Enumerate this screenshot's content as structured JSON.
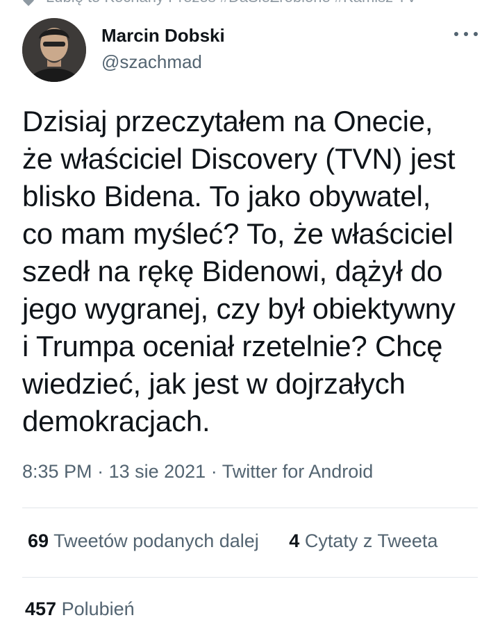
{
  "top_context": {
    "text": "Lubię to Kochany Prezes #DaSieZrobione #Kamisz TV"
  },
  "author": {
    "name": "Marcin Dobski",
    "handle": "@szachmad"
  },
  "tweet": {
    "lines": [
      "Dzisiaj przeczytałem na Onecie,",
      "że właściciel Discovery (TVN) jest",
      "blisko Bidena. To jako obywatel,",
      "co mam myśleć? To, że właściciel",
      "szedł na rękę Bidenowi, dążył do",
      "jego wygranej, czy był obiektywny",
      "i Trumpa oceniał rzetelnie? Chcę",
      "wiedzieć, jak jest w dojrzałych",
      "demokracjach."
    ]
  },
  "meta": {
    "time": "8:35 PM",
    "separator": " · ",
    "date": "13 sie 2021",
    "source": "Twitter for Android"
  },
  "stats": {
    "retweets_count": "69",
    "retweets_label": "Tweetów podanych dalej",
    "quotes_count": "4",
    "quotes_label": "Cytaty z Tweeta",
    "likes_count": "457",
    "likes_label": "Polubień"
  },
  "icons": {
    "more": "more-horizontal-icon",
    "pin": "pin-icon"
  },
  "colors": {
    "text_primary": "#0f1419",
    "text_secondary": "#536471",
    "divider": "#e1e6ea"
  }
}
